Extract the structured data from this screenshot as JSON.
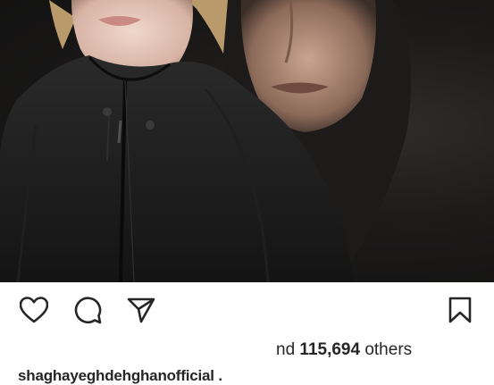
{
  "post": {
    "image_alt": "Two women in dark clothing against a black background",
    "likes_prefix": "nd ",
    "likes_count": "115,694",
    "likes_suffix": " others",
    "caption_username": "shaghayeghdehghanofficial",
    "caption_text": " ."
  },
  "icons": {
    "like": "heart-icon",
    "comment": "comment-icon",
    "share": "paper-plane-icon",
    "save": "bookmark-icon"
  },
  "colors": {
    "text": "#262626",
    "background": "#ffffff"
  }
}
